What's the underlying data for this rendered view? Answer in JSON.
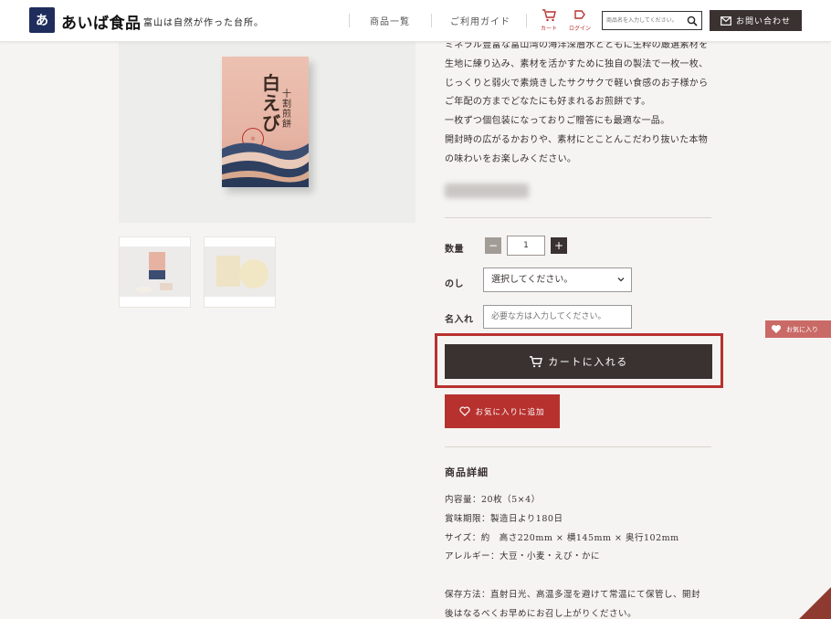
{
  "header": {
    "logo_glyph": "あ",
    "brand": "あいば食品",
    "tagline": "富山は自然が作った台所。",
    "nav": [
      {
        "label": "商品一覧"
      },
      {
        "label": "ご利用ガイド"
      }
    ],
    "cart_label": "カート",
    "login_label": "ログイン",
    "search_placeholder": "商品名を入力してください。",
    "contact_label": "お問い合わせ",
    "accent_color": "#b7312f",
    "dark_color": "#3a3230"
  },
  "product": {
    "box_title": "白えび",
    "box_subtitle": "十割煎餅",
    "description": [
      "ミネラル豊富な富山湾の海洋深層水とともに生粋の厳選素材を",
      "生地に練り込み、素材を活かすために独自の製法で一枚一枚、",
      "じっくりと弱火で素焼きしたサクサクで軽い食感のお子様から",
      "ご年配の方までどなたにも好まれるお煎餅です。",
      "一枚ずつ個包装になっておりご贈答にも最適な一品。",
      "開封時の広がるかおりや、素材にとことんこだわり抜いた本物",
      "の味わいをお楽しみください。"
    ]
  },
  "form": {
    "qty_label": "数量",
    "qty_minus": "−",
    "qty_plus": "+",
    "qty_value": "1",
    "noshi_label": "のし",
    "noshi_selected": "選択してください。",
    "name_label": "名入れ",
    "name_placeholder": "必要な方は入力してください。",
    "cart_button": "カートに入れる",
    "fav_button": "お気に入りに追加"
  },
  "details": {
    "title": "商品詳細",
    "lines": [
      "内容量：20枚（5×4）",
      "賞味期限：製造日より180日",
      "サイズ：約　高さ220mm × 横145mm × 奥行102mm",
      "アレルギー：大豆・小麦・えび・かに"
    ],
    "storage": [
      "保存方法：直射日光、高温多湿を避けて常温にて保管し、開封",
      "後はなるべくお早めにお召し上がりください。"
    ]
  },
  "side_tab": {
    "label": "お気に入り"
  }
}
